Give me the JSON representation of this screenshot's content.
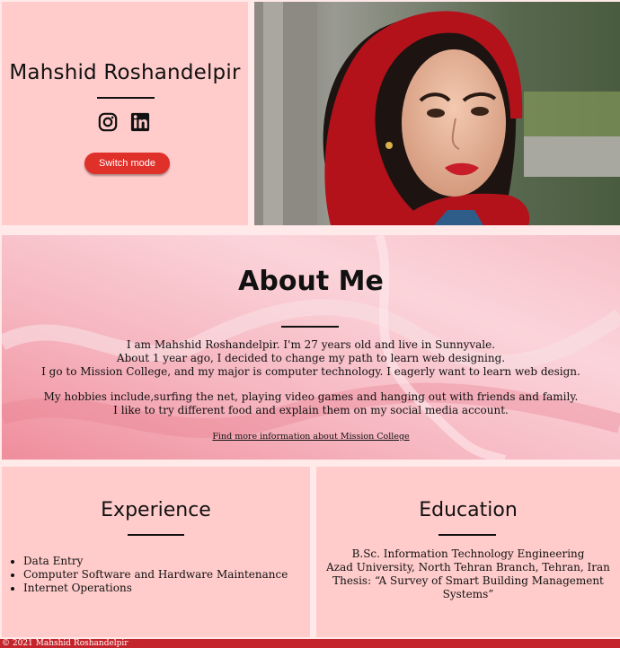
{
  "header": {
    "name": "Mahshid Roshandelpir",
    "switch_button": "Switch mode",
    "social": [
      {
        "icon": "instagram-icon"
      },
      {
        "icon": "linkedin-icon"
      }
    ]
  },
  "about": {
    "title": "About Me",
    "paragraph1": [
      "I am Mahshid Roshandelpir. I'm 27 years old and live in Sunnyvale.",
      "About 1 year ago, I decided to change my path to learn web designing.",
      "I go to Mission College, and my major is computer technology. I eagerly want to learn web design."
    ],
    "paragraph2": [
      "My hobbies include,surfing the net, playing video games and hanging out with friends and family.",
      "I like to try different food and explain them on my social media account."
    ],
    "link": "Find more information about Mission College"
  },
  "experience": {
    "title": "Experience",
    "items": [
      "Data Entry",
      "Computer Software and Hardware Maintenance",
      "Internet Operations"
    ]
  },
  "education": {
    "title": "Education",
    "lines": [
      "B.Sc. Information Technology Engineering",
      "Azad University, North Tehran Branch, Tehran, Iran",
      "Thesis: “A Survey of Smart Building Management Systems”"
    ]
  },
  "footer": {
    "text": "© 2021 Mahshid Roshandelpir"
  },
  "colors": {
    "panel": "#ffcccb",
    "accent": "#e0302a",
    "footer": "#c4242b"
  }
}
